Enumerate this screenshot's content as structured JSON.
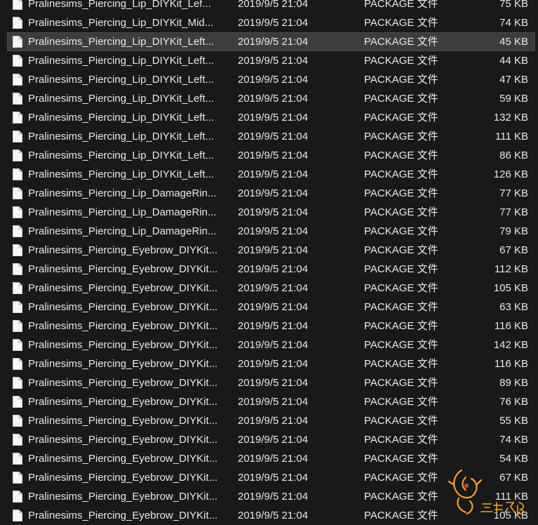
{
  "files": [
    {
      "name": "Pralinesims_Piercing_Lip_DIYKit_Lef...",
      "date": "2019/9/5 21:04",
      "type": "PACKAGE 文件",
      "size": "75 KB"
    },
    {
      "name": "Pralinesims_Piercing_Lip_DIYKit_Mid...",
      "date": "2019/9/5 21:04",
      "type": "PACKAGE 文件",
      "size": "74 KB"
    },
    {
      "name": "Pralinesims_Piercing_Lip_DIYKit_Left...",
      "date": "2019/9/5 21:04",
      "type": "PACKAGE 文件",
      "size": "45 KB",
      "selected": true
    },
    {
      "name": "Pralinesims_Piercing_Lip_DIYKit_Left...",
      "date": "2019/9/5 21:04",
      "type": "PACKAGE 文件",
      "size": "44 KB"
    },
    {
      "name": "Pralinesims_Piercing_Lip_DIYKit_Left...",
      "date": "2019/9/5 21:04",
      "type": "PACKAGE 文件",
      "size": "47 KB"
    },
    {
      "name": "Pralinesims_Piercing_Lip_DIYKit_Left...",
      "date": "2019/9/5 21:04",
      "type": "PACKAGE 文件",
      "size": "59 KB"
    },
    {
      "name": "Pralinesims_Piercing_Lip_DIYKit_Left...",
      "date": "2019/9/5 21:04",
      "type": "PACKAGE 文件",
      "size": "132 KB"
    },
    {
      "name": "Pralinesims_Piercing_Lip_DIYKit_Left...",
      "date": "2019/9/5 21:04",
      "type": "PACKAGE 文件",
      "size": "111 KB"
    },
    {
      "name": "Pralinesims_Piercing_Lip_DIYKit_Left...",
      "date": "2019/9/5 21:04",
      "type": "PACKAGE 文件",
      "size": "86 KB"
    },
    {
      "name": "Pralinesims_Piercing_Lip_DIYKit_Left...",
      "date": "2019/9/5 21:04",
      "type": "PACKAGE 文件",
      "size": "126 KB"
    },
    {
      "name": "Pralinesims_Piercing_Lip_DamageRin...",
      "date": "2019/9/5 21:04",
      "type": "PACKAGE 文件",
      "size": "77 KB"
    },
    {
      "name": "Pralinesims_Piercing_Lip_DamageRin...",
      "date": "2019/9/5 21:04",
      "type": "PACKAGE 文件",
      "size": "77 KB"
    },
    {
      "name": "Pralinesims_Piercing_Lip_DamageRin...",
      "date": "2019/9/5 21:04",
      "type": "PACKAGE 文件",
      "size": "79 KB"
    },
    {
      "name": "Pralinesims_Piercing_Eyebrow_DIYKit...",
      "date": "2019/9/5 21:04",
      "type": "PACKAGE 文件",
      "size": "67 KB"
    },
    {
      "name": "Pralinesims_Piercing_Eyebrow_DIYKit...",
      "date": "2019/9/5 21:04",
      "type": "PACKAGE 文件",
      "size": "112 KB"
    },
    {
      "name": "Pralinesims_Piercing_Eyebrow_DIYKit...",
      "date": "2019/9/5 21:04",
      "type": "PACKAGE 文件",
      "size": "105 KB"
    },
    {
      "name": "Pralinesims_Piercing_Eyebrow_DIYKit...",
      "date": "2019/9/5 21:04",
      "type": "PACKAGE 文件",
      "size": "63 KB"
    },
    {
      "name": "Pralinesims_Piercing_Eyebrow_DIYKit...",
      "date": "2019/9/5 21:04",
      "type": "PACKAGE 文件",
      "size": "116 KB"
    },
    {
      "name": "Pralinesims_Piercing_Eyebrow_DIYKit...",
      "date": "2019/9/5 21:04",
      "type": "PACKAGE 文件",
      "size": "142 KB"
    },
    {
      "name": "Pralinesims_Piercing_Eyebrow_DIYKit...",
      "date": "2019/9/5 21:04",
      "type": "PACKAGE 文件",
      "size": "116 KB"
    },
    {
      "name": "Pralinesims_Piercing_Eyebrow_DIYKit...",
      "date": "2019/9/5 21:04",
      "type": "PACKAGE 文件",
      "size": "89 KB"
    },
    {
      "name": "Pralinesims_Piercing_Eyebrow_DIYKit...",
      "date": "2019/9/5 21:04",
      "type": "PACKAGE 文件",
      "size": "76 KB"
    },
    {
      "name": "Pralinesims_Piercing_Eyebrow_DIYKit...",
      "date": "2019/9/5 21:04",
      "type": "PACKAGE 文件",
      "size": "55 KB"
    },
    {
      "name": "Pralinesims_Piercing_Eyebrow_DIYKit...",
      "date": "2019/9/5 21:04",
      "type": "PACKAGE 文件",
      "size": "74 KB"
    },
    {
      "name": "Pralinesims_Piercing_Eyebrow_DIYKit...",
      "date": "2019/9/5 21:04",
      "type": "PACKAGE 文件",
      "size": "54 KB"
    },
    {
      "name": "Pralinesims_Piercing_Eyebrow_DIYKit...",
      "date": "2019/9/5 21:04",
      "type": "PACKAGE 文件",
      "size": "67 KB"
    },
    {
      "name": "Pralinesims_Piercing_Eyebrow_DIYKit...",
      "date": "2019/9/5 21:04",
      "type": "PACKAGE 文件",
      "size": "111 KB"
    },
    {
      "name": "Pralinesims_Piercing_Eyebrow_DIYKit...",
      "date": "2019/9/5 21:04",
      "type": "PACKAGE 文件",
      "size": "105 KB"
    }
  ],
  "icons": {
    "file": "file-icon",
    "watermark": "watermark-logo"
  },
  "colors": {
    "background": "#191919",
    "selected_row": "#3d3d3d",
    "text": "#e8e8e8",
    "watermark": "#f2a33a"
  }
}
